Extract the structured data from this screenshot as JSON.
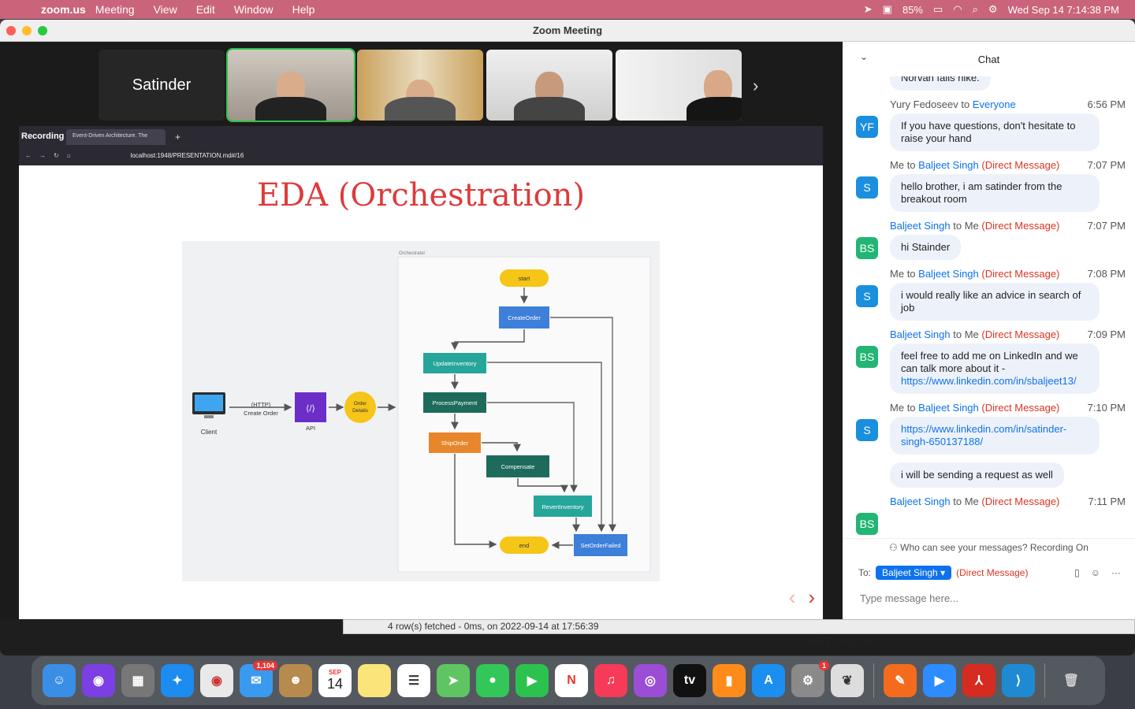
{
  "menubar": {
    "app": "zoom.us",
    "items": [
      "Meeting",
      "View",
      "Edit",
      "Window",
      "Help"
    ],
    "battery": "85%",
    "clock": "Wed Sep 14  7:14:38 PM"
  },
  "window": {
    "title": "Zoom Meeting"
  },
  "participants": {
    "self_name": "Satinder"
  },
  "recording": "Recording",
  "browser": {
    "tab_title": "Event-Driven Architecture. The",
    "url": "localhost:1948/PRESENTATION.md#/16"
  },
  "slide": {
    "title": "EDA (Orchestration)",
    "diagram": {
      "orchestrator": "Orchestrator",
      "client": "Client",
      "http": "(HTTP)",
      "create_order": "Create Order",
      "api": "API",
      "order_details_1": "Order",
      "order_details_2": "Details",
      "start": "start",
      "createorder": "CreateOrder",
      "updateinventory": "UpdateInventory",
      "processpayment": "ProcessPayment",
      "shiporder": "ShipOrder",
      "compensate": "Compensate",
      "revertinventory": "RevertInventory",
      "end": "end",
      "setorderfailed": "SetOrderFailed"
    }
  },
  "chat": {
    "title": "Chat",
    "prev_partial": "Norvan fails hike.",
    "messages": [
      {
        "from": "Yury Fedoseev",
        "to": "Everyone",
        "time": "6:56 PM",
        "text": "If you have questions, don't hesitate to raise your hand",
        "avatar": "YF"
      },
      {
        "from": "Me",
        "to": "Baljeet Singh",
        "dm": "(Direct Message)",
        "time": "7:07 PM",
        "text": "hello brother,  i am satinder from the breakout room",
        "avatar": "S"
      },
      {
        "from": "Baljeet Singh",
        "to": "Me",
        "dm": "(Direct Message)",
        "time": "7:07 PM",
        "text": "hi Stainder",
        "avatar": "BS"
      },
      {
        "from": "Me",
        "to": "Baljeet Singh",
        "dm": "(Direct Message)",
        "time": "7:08 PM",
        "text": "i would really like an advice in search of job",
        "avatar": "S"
      },
      {
        "from": "Baljeet Singh",
        "to": "Me",
        "dm": "(Direct Message)",
        "time": "7:09 PM",
        "text": "feel free to add me on LinkedIn and we can talk more about it - ",
        "link": "https://www.linkedin.com/in/sbaljeet13/",
        "avatar": "BS"
      },
      {
        "from": "Me",
        "to": "Baljeet Singh",
        "dm": "(Direct Message)",
        "time": "7:10 PM",
        "link": "https://www.linkedin.com/in/satinder-singh-650137188/",
        "avatar": "S"
      },
      {
        "from": "Baljeet Singh",
        "to": "Me",
        "dm": "(Direct Message)",
        "time": "7:11 PM",
        "text": "",
        "avatar": "BS"
      }
    ],
    "followup": "i will be sending a request as well",
    "to_word": "to",
    "who_can_see": "Who can see your messages? Recording On",
    "to_label": "To:",
    "recipient": "Baljeet Singh",
    "recipient_dm": "(Direct Message)",
    "placeholder": "Type message here..."
  },
  "status": {
    "text": "4 row(s) fetched - 0ms, on 2022-09-14 at 17:56:39",
    "tz": "MST",
    "locale": "en_US"
  },
  "dock": {
    "mail_badge": "1,104",
    "cal_month": "SEP",
    "cal_day": "14",
    "settings_badge": "1"
  }
}
